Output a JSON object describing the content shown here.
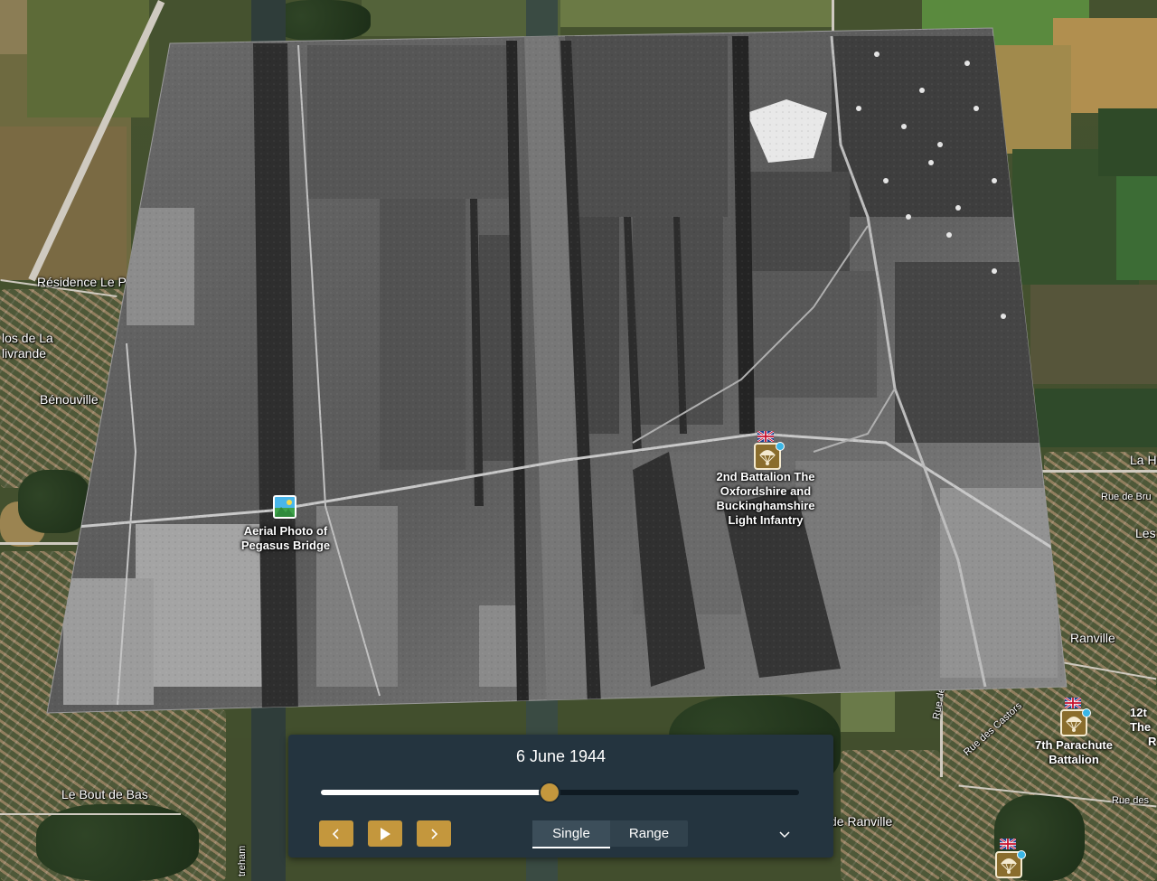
{
  "map": {
    "labels": [
      {
        "id": "residence",
        "text": "Résidence Le P"
      },
      {
        "id": "clos1",
        "text": "los de La"
      },
      {
        "id": "clos2",
        "text": "livrande"
      },
      {
        "id": "benouville",
        "text": "Bénouville"
      },
      {
        "id": "bout",
        "text": "Le Bout de Bas"
      },
      {
        "id": "ranville",
        "text": "Ranville"
      },
      {
        "id": "deranville",
        "text": "de Ranville"
      },
      {
        "id": "lah",
        "text": "La H"
      },
      {
        "id": "les",
        "text": "Les"
      },
      {
        "id": "ruebru",
        "text": "Rue de Bru"
      },
      {
        "id": "ruedes",
        "text": "Rue des"
      },
      {
        "id": "ruecastors",
        "text": "Rue des Castors"
      },
      {
        "id": "ruede",
        "text": "Rue de"
      },
      {
        "id": "ouistreham",
        "text": "treham"
      }
    ]
  },
  "markers": {
    "photo": {
      "label_line1": "Aerial Photo of",
      "label_line2": "Pegasus Bridge",
      "icon": "image-icon"
    },
    "battalion_2nd": {
      "line1": "2nd Battalion The",
      "line2": "Oxfordshire and",
      "line3": "Buckinghamshire",
      "line4": "Light Infantry",
      "icon": "parachute-icon",
      "flag": "union-jack"
    },
    "battalion_7th": {
      "line1": "7th Parachute",
      "line2": "Battalion",
      "icon": "parachute-icon",
      "flag": "union-jack"
    },
    "battalion_12th": {
      "line1": "12t",
      "line2": "The",
      "line3": "R",
      "icon": "parachute-icon"
    },
    "bottom_marker": {
      "icon": "parachute-icon",
      "flag": "union-jack"
    }
  },
  "time_slider": {
    "date": "6 June 1944",
    "progress": 0.479,
    "prev_icon": "chevron-left-icon",
    "play_icon": "play-icon",
    "next_icon": "chevron-right-icon",
    "mode_single": "Single",
    "mode_range": "Range",
    "active_mode": "Single",
    "expand_icon": "chevron-down-icon"
  },
  "colors": {
    "accent": "#c4973d",
    "panel": "#24343f",
    "marker_pin": "#8a6d2d",
    "marker_dot": "#3ab6e6"
  }
}
